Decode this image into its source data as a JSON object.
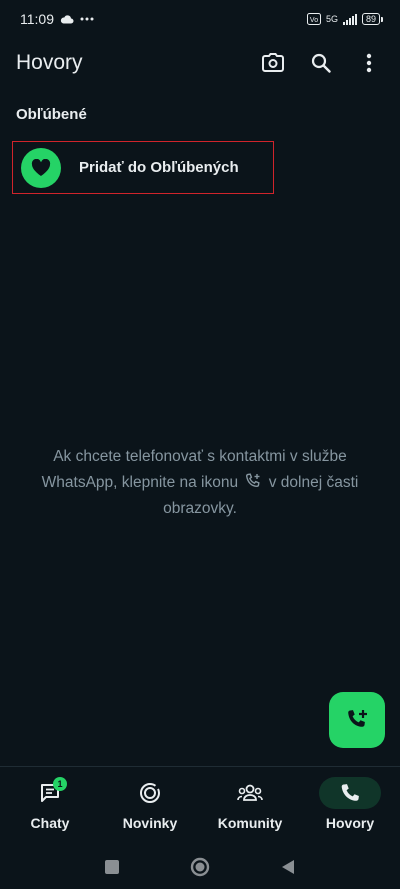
{
  "status_bar": {
    "time": "11:09",
    "network": "5G",
    "battery": "89",
    "icons": [
      "cloud-icon",
      "more-dots-icon",
      "volte-icon",
      "signal-icon",
      "battery-icon"
    ]
  },
  "app_bar": {
    "title": "Hovory",
    "actions": [
      "camera-icon",
      "search-icon",
      "overflow-menu-icon"
    ]
  },
  "favorites": {
    "section_title": "Obľúbené",
    "add_label": "Pridať do Obľúbených",
    "icon": "heart-icon"
  },
  "empty_state": {
    "text_before": "Ak chcete telefonovať s kontaktmi v službe WhatsApp, klepnite na ikonu",
    "text_after": "v dolnej časti obrazovky.",
    "icon": "add-call-icon"
  },
  "fab": {
    "icon": "add-call-icon"
  },
  "bottom_nav": {
    "items": [
      {
        "label": "Chaty",
        "icon": "chat-icon",
        "badge": "1"
      },
      {
        "label": "Novinky",
        "icon": "updates-icon"
      },
      {
        "label": "Komunity",
        "icon": "communities-icon"
      },
      {
        "label": "Hovory",
        "icon": "phone-icon",
        "active": true
      }
    ]
  },
  "colors": {
    "background": "#0b141a",
    "accent": "#25d366",
    "muted_text": "#8696a0",
    "active_nav_pill": "#103529",
    "highlight_border": "#d0242b"
  }
}
